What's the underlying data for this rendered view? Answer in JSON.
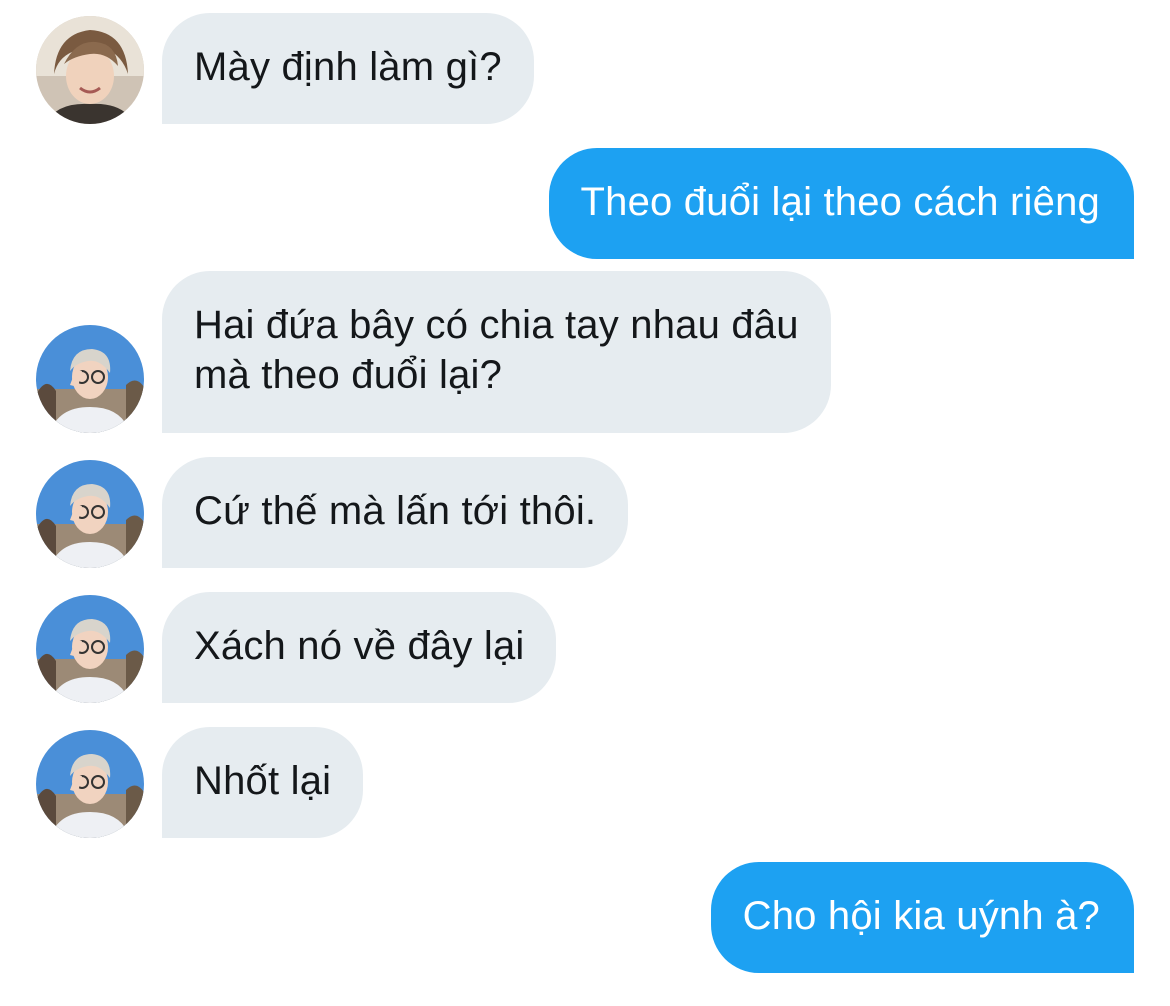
{
  "conversation": {
    "messages": [
      {
        "side": "in",
        "avatar": "avatar-1",
        "lines": [
          "Mày định làm gì?"
        ]
      },
      {
        "side": "out",
        "lines": [
          "Theo đuổi lại theo cách riêng"
        ]
      },
      {
        "side": "in",
        "avatar": "avatar-2",
        "lines": [
          "Hai đứa bây có chia tay nhau đâu",
          "mà theo đuổi lại?"
        ]
      },
      {
        "side": "in",
        "avatar": "avatar-2",
        "lines": [
          "Cứ thế mà lấn tới thôi."
        ]
      },
      {
        "side": "in",
        "avatar": "avatar-2",
        "lines": [
          "Xách nó về đây lại"
        ]
      },
      {
        "side": "in",
        "avatar": "avatar-2",
        "lines": [
          "Nhốt lại"
        ]
      },
      {
        "side": "out",
        "lines": [
          "Cho hội kia uýnh à?"
        ]
      }
    ]
  },
  "colors": {
    "incoming_bubble": "#e6ecf0",
    "incoming_text": "#14171a",
    "outgoing_bubble": "#1da1f2",
    "outgoing_text": "#ffffff",
    "background": "#ffffff"
  }
}
